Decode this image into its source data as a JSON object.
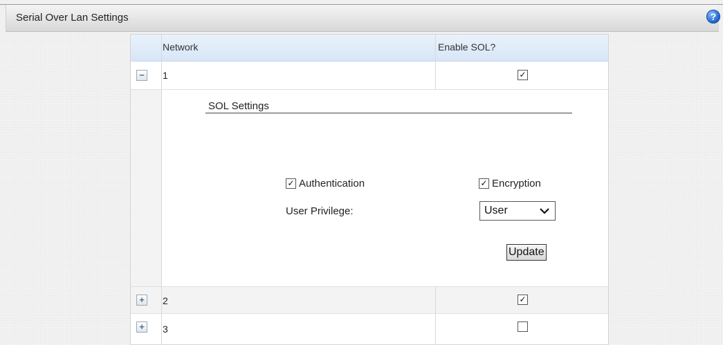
{
  "panel": {
    "title": "Serial Over Lan Settings",
    "help_icon": "?"
  },
  "table": {
    "columns": [
      "Network",
      "Enable SOL?"
    ],
    "rows": [
      {
        "toggle": "−",
        "network": "1",
        "enabled": true,
        "expanded": true
      },
      {
        "toggle": "+",
        "network": "2",
        "enabled": true,
        "expanded": false
      },
      {
        "toggle": "+",
        "network": "3",
        "enabled": false,
        "expanded": false
      }
    ]
  },
  "sol_settings": {
    "title": "SOL Settings",
    "authentication": {
      "label": "Authentication",
      "checked": true
    },
    "encryption": {
      "label": "Encryption",
      "checked": true
    },
    "privilege_label": "User Privilege:",
    "privilege_value": "User",
    "update_label": "Update"
  },
  "glyphs": {
    "check": "✓",
    "chevron": "❯"
  }
}
